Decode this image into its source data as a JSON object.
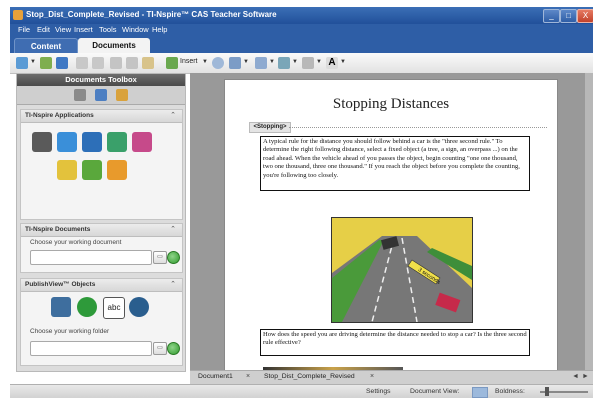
{
  "window": {
    "title": "Stop_Dist_Complete_Revised - TI-Nspire™ CAS Teacher Software",
    "controls": [
      "_",
      "□",
      "X"
    ]
  },
  "menu": [
    "File",
    "Edit",
    "View",
    "Insert",
    "Tools",
    "Window",
    "Help"
  ],
  "tabs": [
    {
      "label": "Content",
      "active": false
    },
    {
      "label": "Documents",
      "active": true
    }
  ],
  "toolbar": {
    "insert_label": "Insert",
    "icons": [
      "new-document-icon",
      "open-icon",
      "save-icon",
      "undo-icon",
      "redo-icon",
      "cut-icon",
      "copy-icon",
      "paste-icon",
      "insert-page-icon",
      "screen-capture-icon",
      "display-icon",
      "page-layout-icon",
      "fill-color-icon",
      "line-color-icon",
      "text-color-icon"
    ]
  },
  "toolbox": {
    "title": "Documents Toolbox",
    "tabs": [
      "tools-icon",
      "page-sorter-icon",
      "content-explorer-icon"
    ],
    "applications": {
      "title": "TI-Nspire Applications",
      "apps": [
        "calculator-icon",
        "graphs-icon",
        "geometry-icon",
        "lists-spreadsheet-icon",
        "data-statistics-icon",
        "notes-icon",
        "vernier-dataquest-icon",
        "question-icon"
      ]
    },
    "documents": {
      "title": "TI-Nspire Documents",
      "field_label": "Choose your working document",
      "value": ""
    },
    "publishview": {
      "title": "PublishView™ Objects",
      "objects": [
        "image-object-icon",
        "video-object-icon",
        "text-object-icon",
        "ti-nspire-object-icon"
      ],
      "text_object_label": "abc",
      "field_label": "Choose your working folder",
      "value": ""
    }
  },
  "document": {
    "title": "Stopping Distances",
    "section": "<Stopping>",
    "paragraph1": "A typical rule for the distance you should follow behind a car is the \"three second rule.\" To determine the right following distance, select a fixed object (a tree, a sign, an overpass ...) on the road ahead. When the vehicle ahead of you passes the object, begin counting \"one one thousand, two one thousand, three one thousand.\" If you reach the object before you complete the counting, you're following too closely.",
    "figure_label": "3 seconds",
    "paragraph2": "How does the speed you are driving determine the distance needed to stop a car? Is the three second rule effective?"
  },
  "doc_tabs": [
    {
      "label": "Document1",
      "close": "×"
    },
    {
      "label": "Stop_Dist_Complete_Revised",
      "close": "×"
    }
  ],
  "doc_nav": [
    "◄",
    "►"
  ],
  "status": {
    "settings": "Settings",
    "document_view": "Document View:",
    "boldness": "Boldness:"
  }
}
